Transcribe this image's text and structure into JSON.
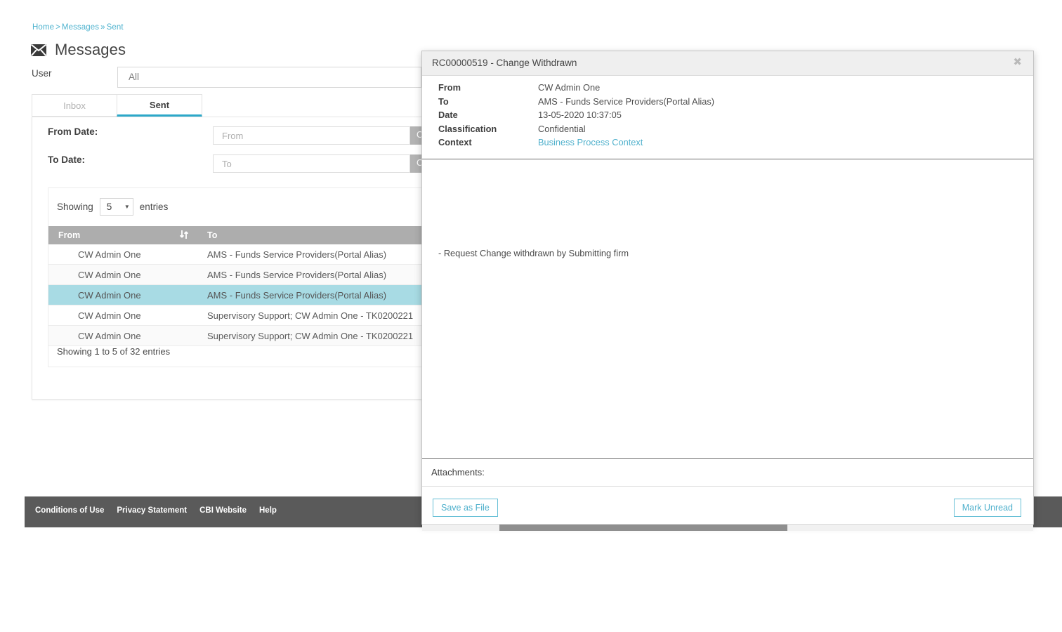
{
  "breadcrumb": {
    "home": "Home",
    "sep1": ">",
    "messages": "Messages",
    "sep2": "»",
    "sent": "Sent"
  },
  "header": {
    "title": "Messages",
    "icon": "mail-icon"
  },
  "filters": {
    "user_label": "User",
    "user_value": "All",
    "from_date_label": "From Date:",
    "from_date_placeholder": "From",
    "from_clear_label": "Clear",
    "to_date_label": "To Date:",
    "to_date_placeholder": "To",
    "to_clear_label": "Clear"
  },
  "tabs": [
    {
      "label": "Inbox",
      "active": false
    },
    {
      "label": "Sent",
      "active": true
    }
  ],
  "table": {
    "showing_prefix": "Showing",
    "entries_value": "5",
    "entries_suffix": "entries",
    "columns": [
      "From",
      "To"
    ],
    "rows": [
      {
        "from": "CW Admin One",
        "to": "AMS - Funds Service Providers(Portal Alias)"
      },
      {
        "from": "CW Admin One",
        "to": "AMS - Funds Service Providers(Portal Alias)"
      },
      {
        "from": "CW Admin One",
        "to": "AMS - Funds Service Providers(Portal Alias)"
      },
      {
        "from": "CW Admin One",
        "to": "Supervisory Support; CW Admin One - TK0200221"
      },
      {
        "from": "CW Admin One",
        "to": "Supervisory Support; CW Admin One - TK0200221"
      }
    ],
    "selected_row_index": 2,
    "footer_text": "Showing 1 to 5 of 32 entries"
  },
  "modal": {
    "title": "RC00000519 - Change Withdrawn",
    "close_icon": "close-icon",
    "meta": [
      {
        "label": "From",
        "value": "CW Admin One",
        "link": false
      },
      {
        "label": "To",
        "value": "AMS - Funds Service Providers(Portal Alias)",
        "link": false
      },
      {
        "label": "Date",
        "value": "13-05-2020 10:37:05",
        "link": false
      },
      {
        "label": "Classification",
        "value": "Confidential",
        "link": false
      },
      {
        "label": "Context",
        "value": "Business Process Context",
        "link": true
      }
    ],
    "body_text": "- Request Change withdrawn by Submitting firm",
    "attachments_label": "Attachments:",
    "save_label": "Save as File",
    "mark_unread_label": "Mark Unread"
  },
  "footer": {
    "links": [
      "Conditions of Use",
      "Privacy Statement",
      "CBI Website",
      "Help"
    ]
  },
  "colors": {
    "accent_teal": "#2ca8c9",
    "link_blue": "#4eb0cc",
    "selected_row": "#a8dbe4",
    "table_header_gray": "#adadad",
    "footer_gray": "#5a5a5a"
  }
}
